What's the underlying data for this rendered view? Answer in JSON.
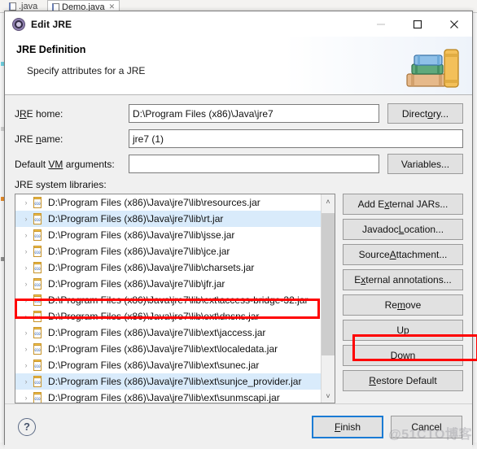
{
  "background": {
    "tabs": [
      {
        "label": ".java",
        "icon": "java-file-icon",
        "active": false
      },
      {
        "label": "Demo.java",
        "icon": "java-file-icon",
        "close": "✕",
        "active": true
      }
    ]
  },
  "window": {
    "title": "Edit JRE",
    "icon": "jre-gear-icon",
    "controls": {
      "minimize": "minimize-icon",
      "maximize": "maximize-icon",
      "close": "close-icon"
    }
  },
  "header": {
    "title": "JRE Definition",
    "subtitle": "Specify attributes for a JRE",
    "art": "books-stack-icon"
  },
  "form": {
    "jre_home": {
      "label_pre": "J",
      "label_accel": "R",
      "label_post": "E home:",
      "label": "JRE home:",
      "value": "D:\\Program Files (x86)\\Java\\jre7",
      "placeholder": "",
      "button": "Directory...",
      "button_pre": "Direct",
      "button_accel": "o",
      "button_post": "ry..."
    },
    "jre_name": {
      "label_pre": "JRE ",
      "label_accel": "n",
      "label_post": "ame:",
      "label": "JRE name:",
      "value": "jre7 (1)",
      "placeholder": ""
    },
    "vm_args": {
      "label_pre": "Default ",
      "label_accel": "VM",
      "label_post": " arguments:",
      "label": "Default VM arguments:",
      "value": "",
      "placeholder": "",
      "button": "Variables...",
      "button_pre": "Variables...",
      "button_accel": "",
      "button_post": ""
    },
    "libraries_label": "JRE system libraries:"
  },
  "libraries": {
    "rows": [
      {
        "path": "D:\\Program Files (x86)\\Java\\jre7\\lib\\resources.jar",
        "icon": "jar-icon",
        "expand": "›",
        "selected": false,
        "highlighted": false
      },
      {
        "path": "D:\\Program Files (x86)\\Java\\jre7\\lib\\rt.jar",
        "icon": "jar-icon",
        "expand": "›",
        "selected": true,
        "highlighted": true
      },
      {
        "path": "D:\\Program Files (x86)\\Java\\jre7\\lib\\jsse.jar",
        "icon": "jar-icon",
        "expand": "›",
        "selected": false,
        "highlighted": false
      },
      {
        "path": "D:\\Program Files (x86)\\Java\\jre7\\lib\\jce.jar",
        "icon": "jar-icon",
        "expand": "›",
        "selected": false,
        "highlighted": false
      },
      {
        "path": "D:\\Program Files (x86)\\Java\\jre7\\lib\\charsets.jar",
        "icon": "jar-icon",
        "expand": "›",
        "selected": false,
        "highlighted": false
      },
      {
        "path": "D:\\Program Files (x86)\\Java\\jre7\\lib\\jfr.jar",
        "icon": "jar-icon",
        "expand": "›",
        "selected": false,
        "highlighted": false
      },
      {
        "path": "D:\\Program Files (x86)\\Java\\jre7\\lib\\ext\\access-bridge-32.jar",
        "icon": "jar-icon",
        "expand": "›",
        "selected": false,
        "highlighted": false
      },
      {
        "path": "D:\\Program Files (x86)\\Java\\jre7\\lib\\ext\\dnsns.jar",
        "icon": "jar-icon",
        "expand": "›",
        "selected": false,
        "highlighted": false
      },
      {
        "path": "D:\\Program Files (x86)\\Java\\jre7\\lib\\ext\\jaccess.jar",
        "icon": "jar-icon",
        "expand": "›",
        "selected": false,
        "highlighted": false
      },
      {
        "path": "D:\\Program Files (x86)\\Java\\jre7\\lib\\ext\\localedata.jar",
        "icon": "jar-icon",
        "expand": "›",
        "selected": false,
        "highlighted": false
      },
      {
        "path": "D:\\Program Files (x86)\\Java\\jre7\\lib\\ext\\sunec.jar",
        "icon": "jar-icon",
        "expand": "›",
        "selected": false,
        "highlighted": false
      },
      {
        "path": "D:\\Program Files (x86)\\Java\\jre7\\lib\\ext\\sunjce_provider.jar",
        "icon": "jar-icon",
        "expand": "›",
        "selected": true,
        "highlighted": false
      },
      {
        "path": "D:\\Program Files (x86)\\Java\\jre7\\lib\\ext\\sunmscapi.jar",
        "icon": "jar-icon",
        "expand": "›",
        "selected": false,
        "highlighted": false
      }
    ],
    "scrollbar": {
      "up": "˄",
      "down": "˅"
    }
  },
  "side_buttons": [
    {
      "label": "Add External JARs...",
      "pre": "Add E",
      "accel": "x",
      "post": "ternal JARs...",
      "name": "add-external-jars-button"
    },
    {
      "label": "Javadoc Location...",
      "pre": "Javadoc ",
      "accel": "L",
      "post": "ocation...",
      "name": "javadoc-location-button"
    },
    {
      "label": "Source Attachment...",
      "pre": "Source ",
      "accel": "A",
      "post": "ttachment...",
      "name": "source-attachment-button"
    },
    {
      "label": "External annotations...",
      "pre": "E",
      "accel": "x",
      "post": "ternal annotations...",
      "name": "external-annotations-button"
    },
    {
      "label": "Remove",
      "pre": "Re",
      "accel": "m",
      "post": "ove",
      "name": "remove-button"
    },
    {
      "label": "Up",
      "pre": "U",
      "accel": "p",
      "post": "",
      "name": "up-button"
    },
    {
      "label": "Down",
      "pre": "",
      "accel": "D",
      "post": "own",
      "name": "down-button"
    },
    {
      "label": "Restore Default",
      "pre": "",
      "accel": "R",
      "post": "estore Default",
      "name": "restore-default-button"
    }
  ],
  "footer": {
    "help": "?",
    "finish": {
      "label": "Finish",
      "pre": "",
      "accel": "F",
      "post": "inish"
    },
    "cancel": {
      "label": "Cancel",
      "pre": "Cancel",
      "accel": "",
      "post": ""
    }
  },
  "watermark": "@51CTO博客",
  "colors": {
    "accent": "#1a7bd4",
    "annotation": "#ff0000",
    "selection": "#d9ebfb",
    "button_face": "#e1e1e1",
    "dialog_bg": "#f0f0f0"
  }
}
